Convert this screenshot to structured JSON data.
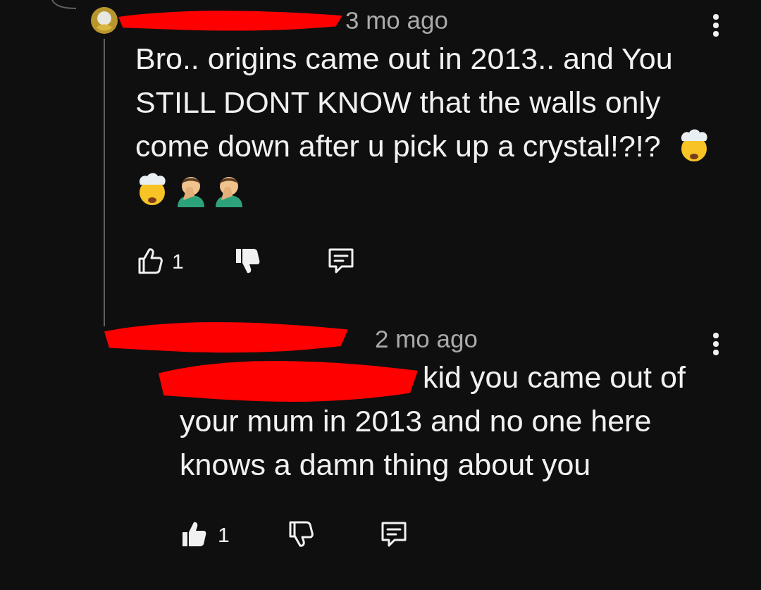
{
  "comments": [
    {
      "time": "3 mo ago",
      "has_avatar": true,
      "name_redacted": true,
      "mention_redacted": false,
      "text": "Bro.. origins came out in 2013.. and You STILL DONT KNOW that the walls only come down after u pick up a crystal!?!?",
      "emojis": [
        {
          "kind": "exploding-head"
        },
        {
          "kind": "exploding-head"
        },
        {
          "kind": "facepalm"
        },
        {
          "kind": "facepalm"
        }
      ],
      "likes": "1",
      "liked": false,
      "disliked": true
    },
    {
      "time": "2 mo ago",
      "has_avatar": false,
      "name_redacted": true,
      "mention_redacted": true,
      "text": "kid you came out of your mum in 2013 and no one here knows a damn thing about you",
      "likes": "1",
      "liked": true,
      "disliked": false
    }
  ]
}
